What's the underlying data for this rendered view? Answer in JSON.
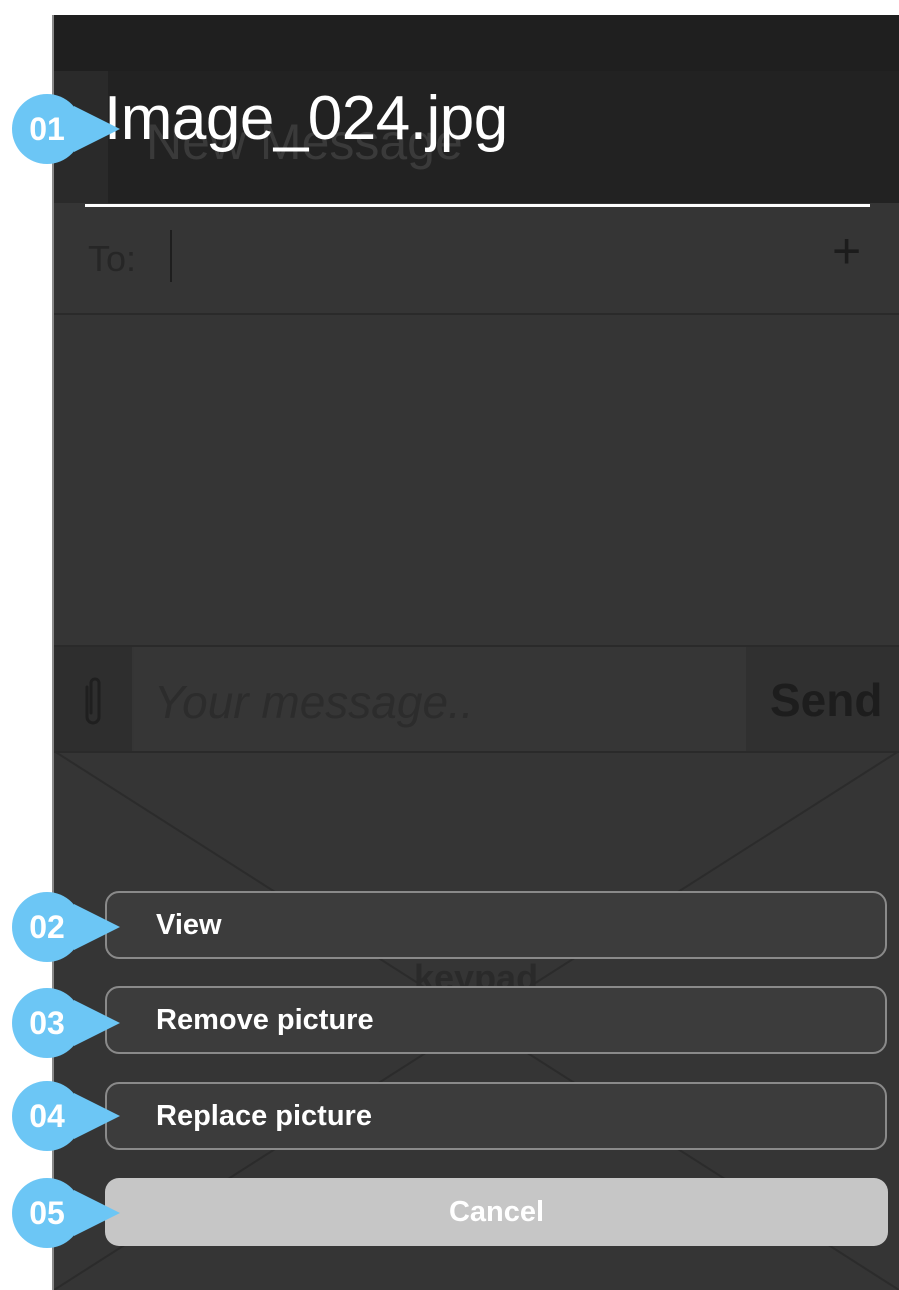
{
  "header": {
    "file_title": "Image_024.jpg",
    "ghost_title": "New Message"
  },
  "recipient": {
    "label": "To:",
    "add_symbol": "+"
  },
  "composer": {
    "placeholder": "Your message..",
    "send_label": "Send",
    "attach_icon": "paperclip-icon"
  },
  "keypad": {
    "label": "keypad"
  },
  "action_sheet": {
    "view_label": "View",
    "remove_label": "Remove picture",
    "replace_label": "Replace picture",
    "cancel_label": "Cancel"
  },
  "callouts": [
    "01",
    "02",
    "03",
    "04",
    "05"
  ],
  "colors": {
    "callout": "#6cc6f5",
    "cancel_bg": "#c6c6c6",
    "screen_bg": "#353535"
  }
}
